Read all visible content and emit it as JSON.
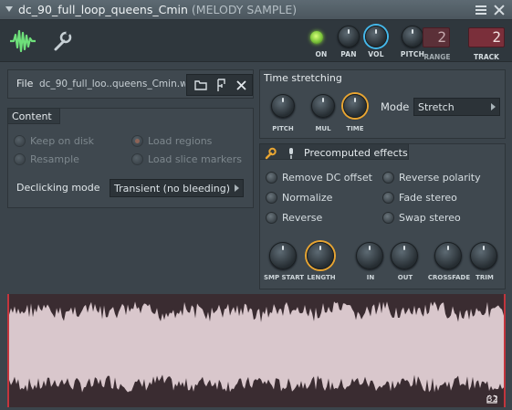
{
  "window": {
    "title": "dc_90_full_loop_queens_Cmin",
    "subtitle": "(MELODY SAMPLE)"
  },
  "header": {
    "knobs": [
      {
        "label": "ON"
      },
      {
        "label": "PAN"
      },
      {
        "label": "VOL"
      },
      {
        "label": "PITCH"
      }
    ],
    "range": {
      "label": "RANGE",
      "value": "2"
    },
    "track": {
      "label": "TRACK",
      "value": "2"
    }
  },
  "file": {
    "label": "File",
    "name": "dc_90_full_loo..queens_Cmin.wav"
  },
  "content": {
    "title": "Content",
    "options": [
      {
        "label": "Keep on disk",
        "checked": false
      },
      {
        "label": "Load regions",
        "checked": true
      },
      {
        "label": "Resample",
        "checked": false
      },
      {
        "label": "Load slice markers",
        "checked": false
      }
    ],
    "declicking": {
      "label": "Declicking mode",
      "value": "Transient (no bleeding)"
    }
  },
  "time_stretching": {
    "title": "Time stretching",
    "knobs": [
      {
        "label": "PITCH"
      },
      {
        "label": "MUL"
      },
      {
        "label": "TIME"
      }
    ],
    "mode": {
      "label": "Mode",
      "value": "Stretch"
    }
  },
  "precomputed": {
    "title": "Precomputed effects",
    "options": [
      {
        "label": "Remove DC offset"
      },
      {
        "label": "Reverse polarity"
      },
      {
        "label": "Normalize"
      },
      {
        "label": "Fade stereo"
      },
      {
        "label": "Reverse"
      },
      {
        "label": "Swap stereo"
      }
    ],
    "knobs": [
      {
        "label": "SMP START"
      },
      {
        "label": "LENGTH"
      },
      {
        "label": "IN"
      },
      {
        "label": "OUT"
      },
      {
        "label": "CROSSFADE"
      },
      {
        "label": "TRIM"
      }
    ]
  },
  "waveform": {
    "zoom": "32",
    "colors": {
      "wave": "#d9c7cc",
      "background": "#3a2c31",
      "marker": "#c2353d"
    }
  },
  "colors": {
    "accent_blue": "#45b8ea",
    "accent_orange": "#e8a532",
    "led_green": "#7bc43a",
    "counter_red": "#7a2f3a"
  }
}
